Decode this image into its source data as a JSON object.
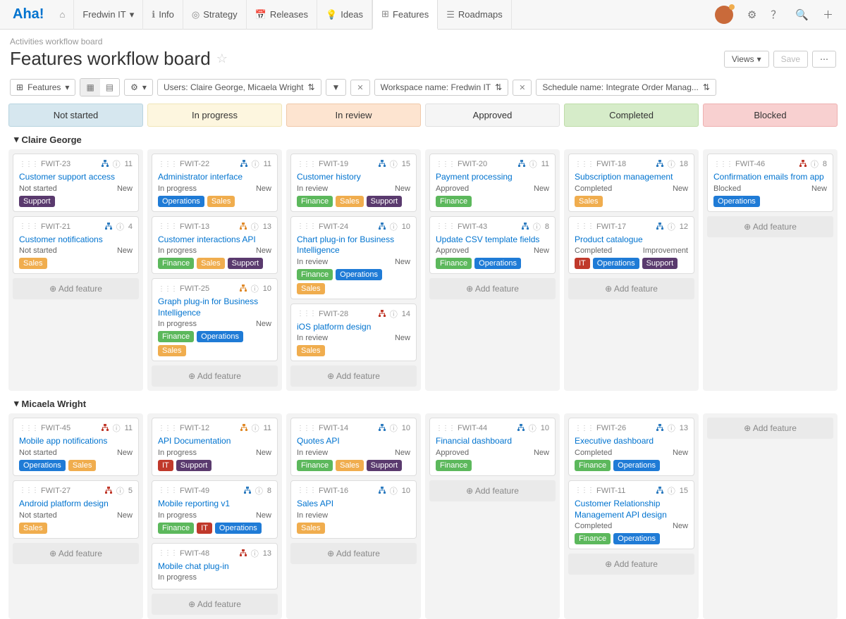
{
  "nav": {
    "logo": "Aha!",
    "workspace": "Fredwin IT",
    "items": [
      {
        "icon": "ℹ",
        "label": "Info"
      },
      {
        "icon": "◎",
        "label": "Strategy"
      },
      {
        "icon": "📅",
        "label": "Releases"
      },
      {
        "icon": "💡",
        "label": "Ideas"
      },
      {
        "icon": "⊞",
        "label": "Features",
        "active": true
      },
      {
        "icon": "☰",
        "label": "Roadmaps"
      }
    ]
  },
  "header": {
    "breadcrumb": "Activities workflow board",
    "title": "Features workflow board",
    "views_btn": "Views",
    "save_btn": "Save"
  },
  "toolbar": {
    "features_btn": "Features",
    "filter_users": "Users: Claire George, Micaela Wright",
    "filter_workspace": "Workspace name: Fredwin IT",
    "filter_schedule": "Schedule name: Integrate Order Manag..."
  },
  "columns": [
    {
      "label": "Not started",
      "cls": "ch-notstarted"
    },
    {
      "label": "In progress",
      "cls": "ch-inprogress"
    },
    {
      "label": "In review",
      "cls": "ch-inreview"
    },
    {
      "label": "Approved",
      "cls": "ch-approved"
    },
    {
      "label": "Completed",
      "cls": "ch-completed"
    },
    {
      "label": "Blocked",
      "cls": "ch-blocked"
    }
  ],
  "add_feature": "Add feature",
  "swimlanes": [
    {
      "name": "Claire George",
      "lanes": [
        [
          {
            "id": "FWIT-23",
            "title": "Customer support access",
            "status": "Not started",
            "state": "New",
            "tree": "blue",
            "count": 11,
            "tags": [
              "Support"
            ]
          },
          {
            "id": "FWIT-21",
            "title": "Customer notifications",
            "status": "Not started",
            "state": "New",
            "tree": "blue",
            "count": 4,
            "tags": [
              "Sales"
            ]
          }
        ],
        [
          {
            "id": "FWIT-22",
            "title": "Administrator interface",
            "status": "In progress",
            "state": "New",
            "tree": "blue",
            "count": 11,
            "tags": [
              "Operations",
              "Sales"
            ]
          },
          {
            "id": "FWIT-13",
            "title": "Customer interactions API",
            "status": "In progress",
            "state": "New",
            "tree": "orange",
            "count": 13,
            "tags": [
              "Finance",
              "Sales",
              "Support"
            ]
          },
          {
            "id": "FWIT-25",
            "title": "Graph plug-in for Business Intelligence",
            "status": "In progress",
            "state": "New",
            "tree": "orange",
            "count": 10,
            "tags": [
              "Finance",
              "Operations",
              "Sales"
            ]
          }
        ],
        [
          {
            "id": "FWIT-19",
            "title": "Customer history",
            "status": "In review",
            "state": "New",
            "tree": "blue",
            "count": 15,
            "tags": [
              "Finance",
              "Sales",
              "Support"
            ]
          },
          {
            "id": "FWIT-24",
            "title": "Chart plug-in for Business Intelligence",
            "status": "In review",
            "state": "New",
            "tree": "blue",
            "count": 10,
            "tags": [
              "Finance",
              "Operations",
              "Sales"
            ]
          },
          {
            "id": "FWIT-28",
            "title": "iOS platform design",
            "status": "In review",
            "state": "New",
            "tree": "red",
            "count": 14,
            "tags": [
              "Sales"
            ]
          }
        ],
        [
          {
            "id": "FWIT-20",
            "title": "Payment processing",
            "status": "Approved",
            "state": "New",
            "tree": "blue",
            "count": 11,
            "tags": [
              "Finance"
            ]
          },
          {
            "id": "FWIT-43",
            "title": "Update CSV template fields",
            "status": "Approved",
            "state": "New",
            "tree": "blue",
            "count": 8,
            "tags": [
              "Finance",
              "Operations"
            ]
          }
        ],
        [
          {
            "id": "FWIT-18",
            "title": "Subscription management",
            "status": "Completed",
            "state": "New",
            "tree": "blue",
            "count": 18,
            "tags": [
              "Sales"
            ]
          },
          {
            "id": "FWIT-17",
            "title": "Product catalogue",
            "status": "Completed",
            "state": "Improvement",
            "tree": "blue",
            "count": 12,
            "tags": [
              "IT",
              "Operations",
              "Support"
            ]
          }
        ],
        [
          {
            "id": "FWIT-46",
            "title": "Confirmation emails from app",
            "status": "Blocked",
            "state": "New",
            "tree": "red",
            "count": 8,
            "tags": [
              "Operations"
            ]
          }
        ]
      ]
    },
    {
      "name": "Micaela Wright",
      "lanes": [
        [
          {
            "id": "FWIT-45",
            "title": "Mobile app notifications",
            "status": "Not started",
            "state": "New",
            "tree": "red",
            "count": 11,
            "tags": [
              "Operations",
              "Sales"
            ]
          },
          {
            "id": "FWIT-27",
            "title": "Android platform design",
            "status": "Not started",
            "state": "New",
            "tree": "red",
            "count": 5,
            "tags": [
              "Sales"
            ]
          }
        ],
        [
          {
            "id": "FWIT-12",
            "title": "API Documentation",
            "status": "In progress",
            "state": "New",
            "tree": "orange",
            "count": 11,
            "tags": [
              "IT",
              "Support"
            ]
          },
          {
            "id": "FWIT-49",
            "title": "Mobile reporting v1",
            "status": "In progress",
            "state": "New",
            "tree": "blue",
            "count": 8,
            "tags": [
              "Finance",
              "IT",
              "Operations"
            ]
          },
          {
            "id": "FWIT-48",
            "title": "Mobile chat plug-in",
            "status": "In progress",
            "state": "",
            "tree": "red",
            "count": 13,
            "tags": []
          }
        ],
        [
          {
            "id": "FWIT-14",
            "title": "Quotes API",
            "status": "In review",
            "state": "New",
            "tree": "blue",
            "count": 10,
            "tags": [
              "Finance",
              "Sales",
              "Support"
            ]
          },
          {
            "id": "FWIT-16",
            "title": "Sales API",
            "status": "In review",
            "state": "",
            "tree": "blue",
            "count": 10,
            "tags": [
              "Sales"
            ]
          }
        ],
        [
          {
            "id": "FWIT-44",
            "title": "Financial dashboard",
            "status": "Approved",
            "state": "New",
            "tree": "blue",
            "count": 10,
            "tags": [
              "Finance"
            ]
          }
        ],
        [
          {
            "id": "FWIT-26",
            "title": "Executive dashboard",
            "status": "Completed",
            "state": "New",
            "tree": "blue",
            "count": 13,
            "tags": [
              "Finance",
              "Operations"
            ]
          },
          {
            "id": "FWIT-11",
            "title": "Customer Relationship Management API design",
            "status": "Completed",
            "state": "New",
            "tree": "blue",
            "count": 15,
            "tags": [
              "Finance",
              "Operations"
            ]
          }
        ],
        []
      ]
    }
  ]
}
